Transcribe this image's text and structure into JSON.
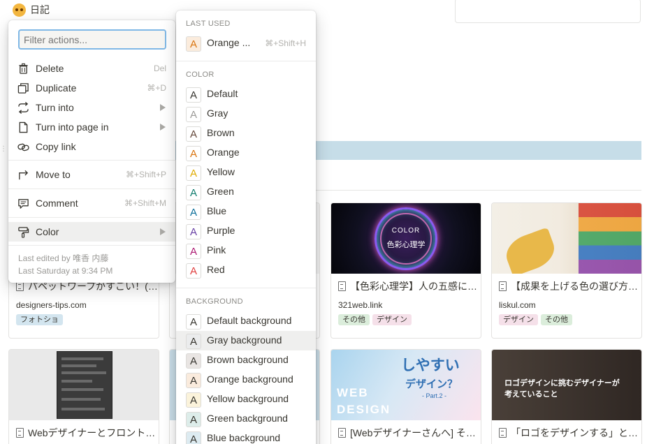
{
  "breadcrumb": {
    "title": "日記"
  },
  "left_menu": {
    "filter_placeholder": "Filter actions...",
    "items": [
      {
        "label": "Delete",
        "shortcut": "Del",
        "icon": "trash-icon"
      },
      {
        "label": "Duplicate",
        "shortcut": "⌘+D",
        "icon": "duplicate-icon"
      },
      {
        "label": "Turn into",
        "shortcut": "",
        "icon": "turn-into-icon"
      },
      {
        "label": "Turn into page in",
        "shortcut": "",
        "icon": "page-icon"
      },
      {
        "label": "Copy link",
        "shortcut": "",
        "icon": "link-icon"
      },
      {
        "label": "Move to",
        "shortcut": "⌘+Shift+P",
        "icon": "move-to-icon"
      },
      {
        "label": "Comment",
        "shortcut": "⌘+Shift+M",
        "icon": "comment-icon"
      },
      {
        "label": "Color",
        "shortcut": "",
        "icon": "paint-roller-icon"
      }
    ],
    "edited_by": "Last edited by 唯香 内藤",
    "edited_time": "Last Saturday at 9:34 PM"
  },
  "color_menu": {
    "last_used_header": "LAST USED",
    "last_used": {
      "label": "Orange ...",
      "shortcut": "⌘+Shift+H",
      "color": "#d9730d",
      "bg": "#fbecdd"
    },
    "color_header": "COLOR",
    "colors": [
      {
        "label": "Default",
        "color": "#37352f"
      },
      {
        "label": "Gray",
        "color": "#9b9a97"
      },
      {
        "label": "Brown",
        "color": "#64473a"
      },
      {
        "label": "Orange",
        "color": "#d9730d"
      },
      {
        "label": "Yellow",
        "color": "#dfab01"
      },
      {
        "label": "Green",
        "color": "#0f7b6c"
      },
      {
        "label": "Blue",
        "color": "#0b6e99"
      },
      {
        "label": "Purple",
        "color": "#6940a5"
      },
      {
        "label": "Pink",
        "color": "#ad1a72"
      },
      {
        "label": "Red",
        "color": "#e03e3e"
      }
    ],
    "background_header": "BACKGROUND",
    "backgrounds": [
      {
        "label": "Default background",
        "bg": "#ffffff"
      },
      {
        "label": "Gray background",
        "bg": "#ebeced"
      },
      {
        "label": "Brown background",
        "bg": "#e9e5e3"
      },
      {
        "label": "Orange background",
        "bg": "#faebdd"
      },
      {
        "label": "Yellow background",
        "bg": "#fbf3db"
      },
      {
        "label": "Green background",
        "bg": "#ddedea"
      },
      {
        "label": "Blue background",
        "bg": "#ddebf1"
      }
    ],
    "swatch_letter": "A"
  },
  "cards": [
    {
      "title": "パペットワープがすごい！(…",
      "url": "designers-tips.com",
      "tags": [
        {
          "label": "フォトショ",
          "color": "blue"
        }
      ]
    },
    {
      "title": "【色彩心理学】人の五感に…",
      "url": "321web.link",
      "thumb_text": [
        "COLOR",
        "色彩心理学"
      ],
      "tags": [
        {
          "label": "その他",
          "color": "green"
        },
        {
          "label": "デザイン",
          "color": "pink"
        }
      ]
    },
    {
      "title": "【成果を上げる色の選び方…",
      "url": "liskul.com",
      "tags": [
        {
          "label": "デザイン",
          "color": "pink"
        },
        {
          "label": "その他",
          "color": "green"
        }
      ]
    },
    {
      "title": "Webデザイナーとフロント…"
    },
    {
      "title": "[Webデザイナーさんへ] そ…",
      "thumb_text": [
        "しやすい",
        "デザイン？",
        "- Part.2 -",
        "WEB",
        "DESIGN"
      ]
    },
    {
      "title": "「ロゴをデザインする」と…",
      "thumb_text": [
        "ロゴデザインに挑むデザイナーが",
        "考えていること"
      ]
    }
  ]
}
